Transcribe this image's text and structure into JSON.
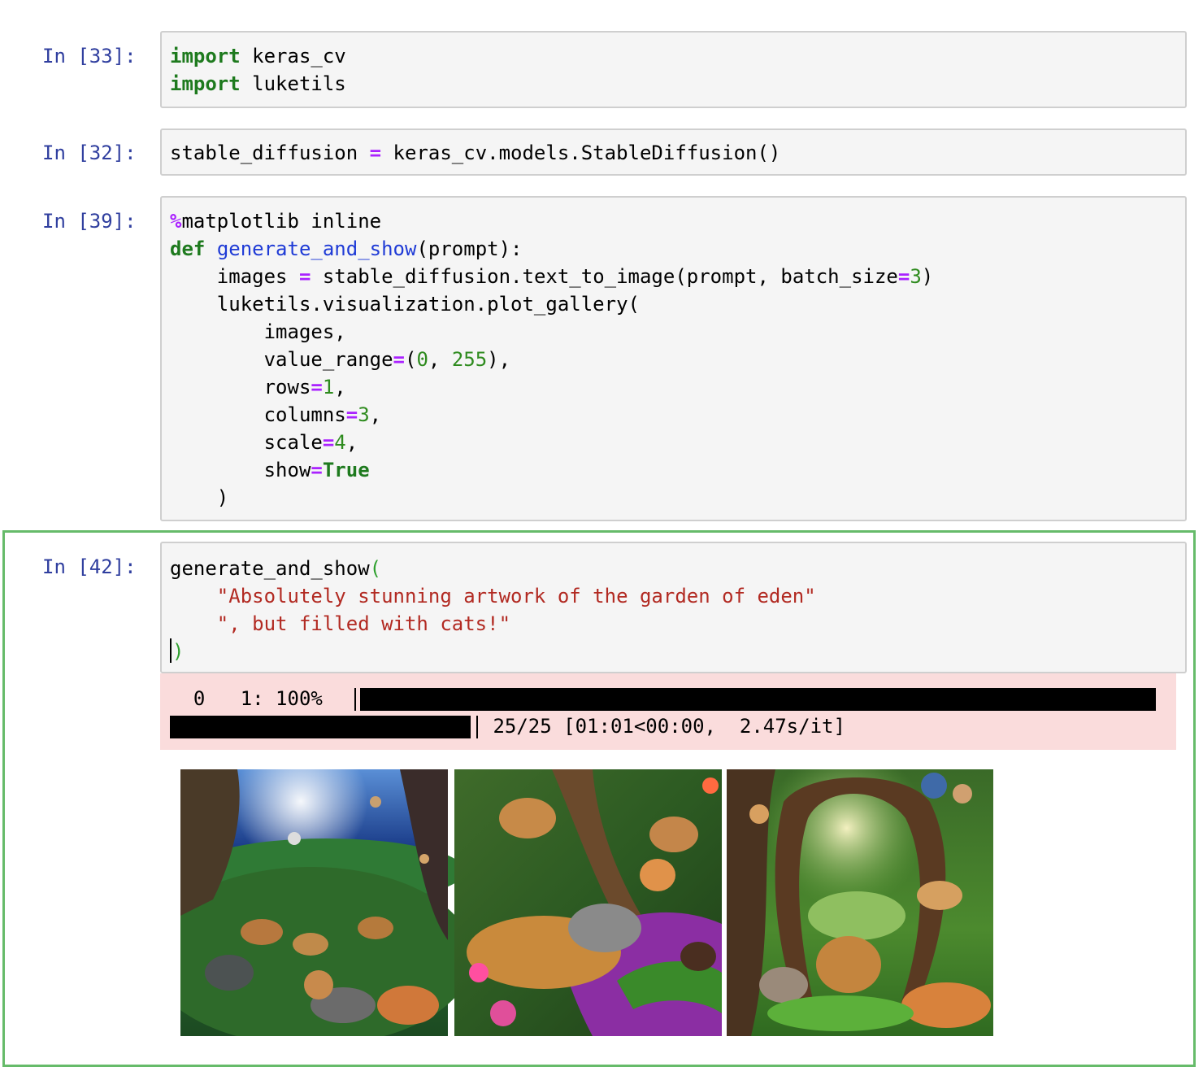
{
  "cells": [
    {
      "prompt": "In [33]:",
      "lines": [
        [
          {
            "t": "import",
            "c": "kw"
          },
          {
            "t": " keras_cv"
          }
        ],
        [
          {
            "t": "import",
            "c": "kw"
          },
          {
            "t": " luketils"
          }
        ]
      ]
    },
    {
      "prompt": "In [32]:",
      "lines": [
        [
          {
            "t": "stable_diffusion "
          },
          {
            "t": "=",
            "c": "op"
          },
          {
            "t": " keras_cv.models.StableDiffusion()"
          }
        ]
      ]
    },
    {
      "prompt": "In [39]:",
      "lines": [
        [
          {
            "t": "%",
            "c": "op"
          },
          {
            "t": "matplotlib inline"
          }
        ],
        [
          {
            "t": "def",
            "c": "kw"
          },
          {
            "t": " "
          },
          {
            "t": "generate_and_show",
            "c": "fn"
          },
          {
            "t": "(prompt):"
          }
        ],
        [
          {
            "t": "    images "
          },
          {
            "t": "=",
            "c": "op"
          },
          {
            "t": " stable_diffusion.text_to_image(prompt, batch_size"
          },
          {
            "t": "=",
            "c": "op"
          },
          {
            "t": "3",
            "c": "num"
          },
          {
            "t": ")"
          }
        ],
        [
          {
            "t": "    luketils.visualization.plot_gallery("
          }
        ],
        [
          {
            "t": "        images,"
          }
        ],
        [
          {
            "t": "        value_range"
          },
          {
            "t": "=",
            "c": "op"
          },
          {
            "t": "("
          },
          {
            "t": "0",
            "c": "num"
          },
          {
            "t": ", "
          },
          {
            "t": "255",
            "c": "num"
          },
          {
            "t": "),"
          }
        ],
        [
          {
            "t": "        rows"
          },
          {
            "t": "=",
            "c": "op"
          },
          {
            "t": "1",
            "c": "num"
          },
          {
            "t": ","
          }
        ],
        [
          {
            "t": "        columns"
          },
          {
            "t": "=",
            "c": "op"
          },
          {
            "t": "3",
            "c": "num"
          },
          {
            "t": ","
          }
        ],
        [
          {
            "t": "        scale"
          },
          {
            "t": "=",
            "c": "op"
          },
          {
            "t": "4",
            "c": "num"
          },
          {
            "t": ","
          }
        ],
        [
          {
            "t": "        show"
          },
          {
            "t": "=",
            "c": "op"
          },
          {
            "t": "True",
            "c": "bt"
          }
        ],
        [
          {
            "t": "    )"
          }
        ]
      ]
    },
    {
      "prompt": "In [42]:",
      "lines": [
        [
          {
            "t": "generate_and_show"
          },
          {
            "t": "(",
            "c": "paren-match"
          }
        ],
        [
          {
            "t": "    "
          },
          {
            "t": "\"Absolutely stunning artwork of the garden of eden\"",
            "c": "str"
          }
        ],
        [
          {
            "t": "    "
          },
          {
            "t": "\", but filled with cats!\"",
            "c": "str"
          }
        ],
        [
          {
            "t": "|CURSOR|"
          },
          {
            "t": ")",
            "c": "paren-match"
          }
        ]
      ]
    }
  ],
  "progress": {
    "line1_left": "  0   1: 100%",
    "line2_right": " 25/25 [01:01<00:00,  2.47s/it]",
    "completed": 25,
    "total": 25,
    "percent": 100
  },
  "gallery": {
    "count": 3,
    "images": [
      {
        "name": "generated-image-1",
        "palette": [
          "#0b2a78",
          "#2d6f2a",
          "#c07a3a",
          "#4a6fa8",
          "#1f4d24"
        ]
      },
      {
        "name": "generated-image-2",
        "palette": [
          "#2f5a22",
          "#c08040",
          "#8a2d9e",
          "#6b4a2a",
          "#3f7a2c"
        ]
      },
      {
        "name": "generated-image-3",
        "palette": [
          "#2a5f1e",
          "#c88a40",
          "#5a3a20",
          "#7fb54a",
          "#e0d9a0"
        ]
      }
    ]
  }
}
